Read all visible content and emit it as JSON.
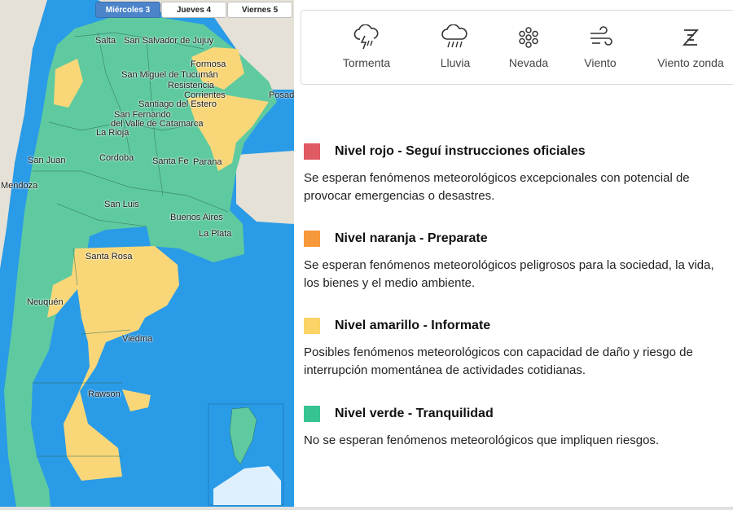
{
  "map": {
    "days": [
      "Miércoles 3",
      "Jueves 4",
      "Viernes 5"
    ],
    "active_day": 0,
    "cities": {
      "salta": "Salta",
      "san_salvador": "San Salvador de Jujuy",
      "formosa": "Formosa",
      "tucuman": "San Miguel de Tucumán",
      "resistencia": "Resistencia",
      "corrientes": "Corrientes",
      "posadas": "Posad",
      "santiago": "Santiago del Estero",
      "catamarca_1": "San Fernando",
      "catamarca_2": "del Valle de Catamarca",
      "la_rioja": "La Rioja",
      "san_juan": "San Juan",
      "cordoba": "Cordoba",
      "santa_fe": "Santa Fe",
      "parana": "Parana",
      "mendoza": "Mendoza",
      "san_luis": "San Luis",
      "buenos_aires": "Buenos Aires",
      "la_plata": "La Plata",
      "santa_rosa": "Santa Rosa",
      "neuquen": "Neuquén",
      "viedma": "Viedma",
      "rawson": "Rawson"
    },
    "colors": {
      "sea": "#2a9be6",
      "green": "#5fcaa0",
      "yellow": "#f9d779",
      "neighbor": "#e6e1d6"
    }
  },
  "alert_types": [
    {
      "label": "Tormenta",
      "icon": "storm-icon"
    },
    {
      "label": "Lluvia",
      "icon": "rain-icon"
    },
    {
      "label": "Nevada",
      "icon": "snowflake-icon"
    },
    {
      "label": "Viento",
      "icon": "wind-icon"
    },
    {
      "label": "Viento zonda",
      "icon": "zonda-icon"
    }
  ],
  "levels": [
    {
      "color": "#e05a63",
      "title": "Nivel rojo - Seguí instrucciones oficiales",
      "description": "Se esperan fenómenos meteorológicos excepcionales con potencial de provocar emergencias o desastres."
    },
    {
      "color": "#f7983a",
      "title": "Nivel naranja - Preparate",
      "description": "Se esperan fenómenos meteorológicos peligrosos para la sociedad, la vida, los bienes y el medio ambiente."
    },
    {
      "color": "#fbd467",
      "title": "Nivel amarillo - Informate",
      "description": "Posibles fenómenos meteorológicos con capacidad de daño y riesgo de interrupción momentánea de actividades cotidianas."
    },
    {
      "color": "#36c592",
      "title": "Nivel verde - Tranquilidad",
      "description": "No se esperan fenómenos meteorológicos que impliquen riesgos."
    }
  ]
}
